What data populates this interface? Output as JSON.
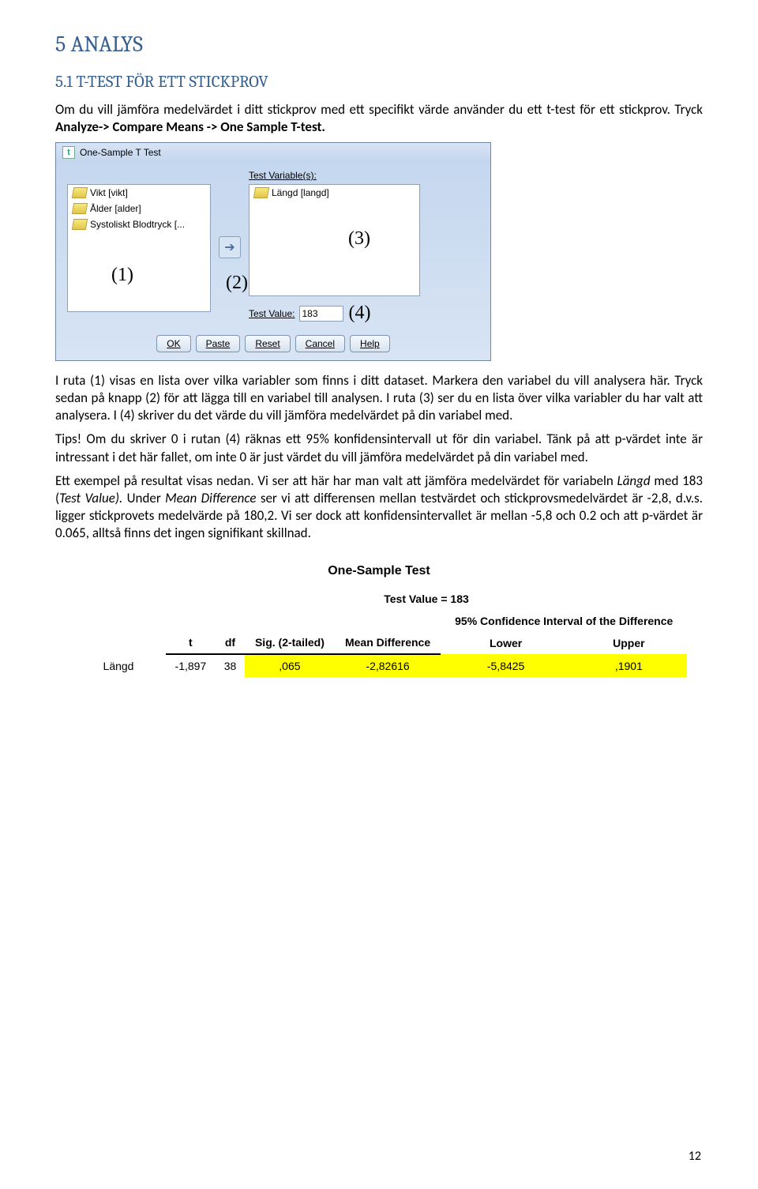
{
  "heading": "5 ANALYS",
  "subheading": "5.1 T-TEST FÖR ETT STICKPROV",
  "para1_a": "Om du vill jämföra medelvärdet i ditt stickprov med ett specifikt värde använder du ett t-test för ett stickprov. Tryck ",
  "para1_b": "Analyze-> Compare Means -> One Sample T-test.",
  "dialog": {
    "title": "One-Sample T Test",
    "left_items": [
      "Vikt [vikt]",
      "Ålder [alder]",
      "Systoliskt Blodtryck [..."
    ],
    "test_var_label": "Test Variable(s):",
    "right_items": [
      "Längd [langd]"
    ],
    "test_value_label": "Test Value:",
    "test_value": "183",
    "annot1": "(1)",
    "annot2": "(2)",
    "annot3": "(3)",
    "annot4": "(4)",
    "buttons": [
      "OK",
      "Paste",
      "Reset",
      "Cancel",
      "Help"
    ]
  },
  "para2": "I ruta (1) visas en lista over vilka variabler som finns i ditt dataset. Markera den variabel du vill analysera här. Tryck sedan på knapp (2) för att lägga till en variabel till analysen. I ruta (3) ser du en lista över vilka variabler du har valt att analysera. I (4) skriver du det värde du vill jämföra medelvärdet på din variabel med.",
  "para3": "Tips! Om du skriver 0 i rutan (4) räknas ett 95% konfidensintervall ut för din variabel. Tänk på att p-värdet inte är intressant i det här fallet, om inte 0 är just värdet du vill jämföra medelvärdet på din variabel med.",
  "para4_a": "Ett exempel på resultat visas nedan. Vi ser att här har man valt att jämföra medelvärdet för variabeln ",
  "para4_i1": "Längd",
  "para4_b": " med 183 (",
  "para4_i2": "Test Value).",
  "para4_c": " Under ",
  "para4_i3": "Mean Difference",
  "para4_d": " ser vi att differensen mellan testvärdet och stickprovsmedelvärdet är -2,8, d.v.s. ligger stickprovets medelvärde på 180,2. Vi ser dock att konfidensintervallet är mellan -5,8 och 0.2 och att p-värdet är 0.065, alltså finns det ingen signifikant skillnad.",
  "table": {
    "caption": "One-Sample Test",
    "span_header": "Test Value = 183",
    "ci_header": "95% Confidence Interval of the Difference",
    "cols": [
      "t",
      "df",
      "Sig. (2-tailed)",
      "Mean Difference",
      "Lower",
      "Upper"
    ],
    "row_label": "Längd",
    "row": [
      "-1,897",
      "38",
      ",065",
      "-2,82616",
      "-5,8425",
      ",1901"
    ]
  },
  "chart_data": {
    "type": "table",
    "title": "One-Sample Test",
    "test_value": 183,
    "columns": [
      "t",
      "df",
      "Sig. (2-tailed)",
      "Mean Difference",
      "CI Lower",
      "CI Upper"
    ],
    "rows": [
      {
        "variable": "Längd",
        "t": -1.897,
        "df": 38,
        "sig_2tailed": 0.065,
        "mean_difference": -2.82616,
        "ci_lower": -5.8425,
        "ci_upper": 0.1901
      }
    ],
    "confidence_level": 0.95
  },
  "page_number": "12"
}
